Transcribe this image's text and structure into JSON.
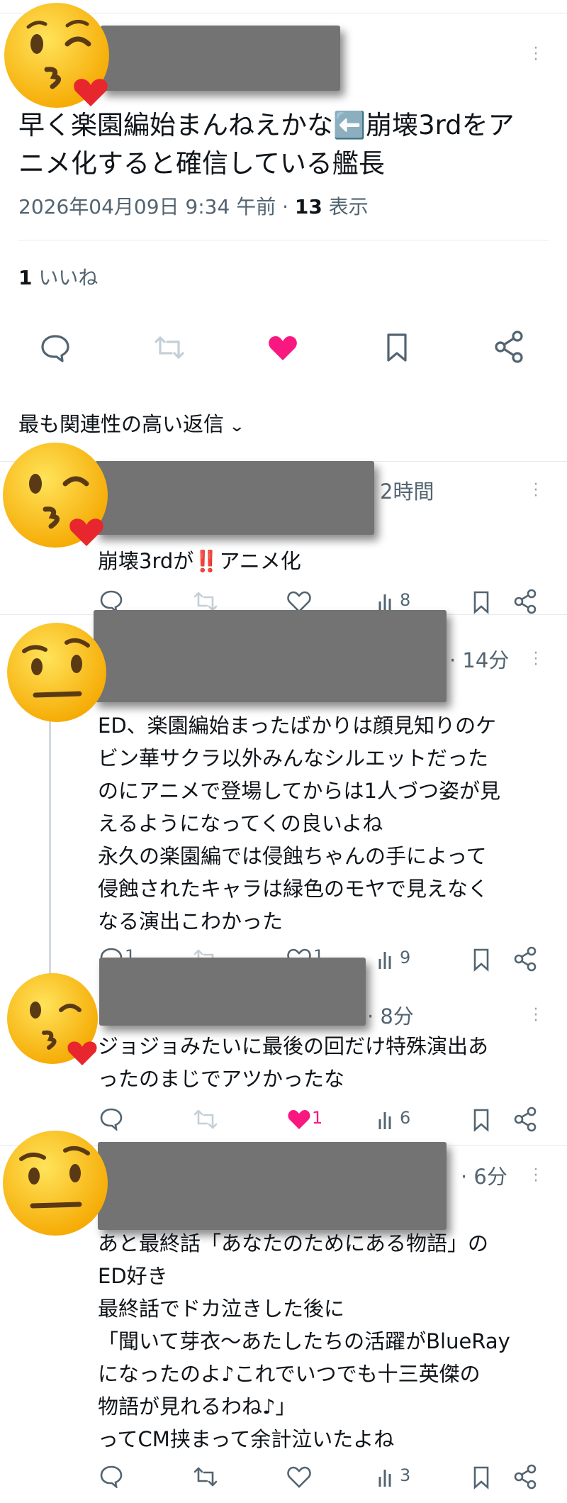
{
  "main_post": {
    "text": "早く楽園編始まんねえかな⬅️崩壊3rdをアニメ化すると確信している艦長",
    "line1": "早く楽園編始まんねえかな⬅️崩壊3rdをア",
    "line2": "ニメ化すると確信している艦長",
    "timestamp": "2026年04月09日 9:34 午前",
    "views_count": "13",
    "views_label": "表示",
    "likes_count": "1",
    "likes_label": "いいね"
  },
  "replies_filter": {
    "label": "最も関連性の高い返信"
  },
  "replies": [
    {
      "time": "2時間",
      "lines": [
        "崩壊3rdが‼️アニメ化"
      ],
      "reply_count": "",
      "retweet_count": "",
      "like_count": "",
      "view_count": "8"
    },
    {
      "time": "· 14分",
      "lines": [
        "ED、楽園編始まったばかりは顔見知りのケ",
        "ビン華サクラ以外みんなシルエットだった",
        "のにアニメで登場してからは1人づつ姿が見",
        "えるようになってくの良いよね",
        "永久の楽園編では侵蝕ちゃんの手によって",
        "侵蝕されたキャラは緑色のモヤで見えなく",
        "なる演出こわかった"
      ],
      "reply_count": "1",
      "retweet_count": "",
      "like_count": "1",
      "view_count": "9"
    },
    {
      "time": "· 8分",
      "lines": [
        "ジョジョみたいに最後の回だけ特殊演出あ",
        "ったのまじでアツかったな"
      ],
      "reply_count": "",
      "retweet_count": "",
      "like_count": "1",
      "view_count": "6"
    },
    {
      "time": "· 6分",
      "lines": [
        "あと最終話「あなたのためにある物語」の",
        "ED好き",
        "最終話でドカ泣きした後に",
        "「聞いて芽衣〜あたしたちの活躍がBlueRay",
        "になったのよ♪これでいつでも十三英傑の",
        "物語が見れるわね♪」",
        "ってCM挟まって余計泣いたよね"
      ],
      "reply_count": "",
      "retweet_count": "",
      "like_count": "",
      "view_count": "3"
    }
  ],
  "colors": {
    "like_active": "#f91880",
    "text": "#0f1419",
    "muted": "#536471",
    "redaction": "#737373"
  },
  "icons": [
    "reply-icon",
    "retweet-icon",
    "like-icon",
    "bookmark-icon",
    "share-icon",
    "views-icon",
    "more-icon",
    "chevron-down-icon"
  ]
}
